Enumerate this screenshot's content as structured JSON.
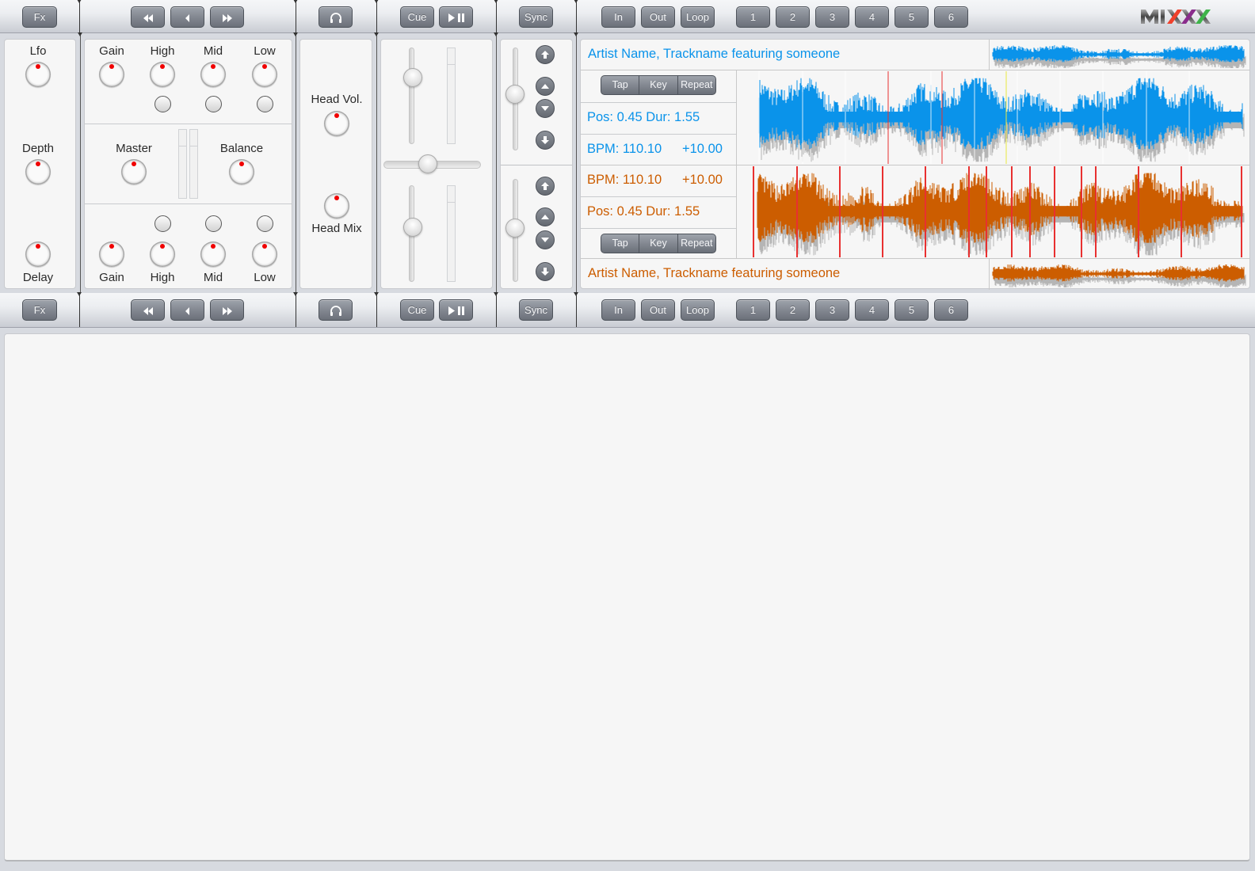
{
  "app": {
    "logo_text": "MIXXX"
  },
  "toolbar_top": {
    "fx_label": "Fx",
    "rewind_icon": "fast-backward-icon",
    "back_icon": "backward-icon",
    "forward_icon": "fast-forward-icon",
    "headphone_icon": "headphones-icon",
    "cue_label": "Cue",
    "play_pause_icon": "play-pause-icon",
    "sync_label": "Sync",
    "loop_in_label": "In",
    "loop_out_label": "Out",
    "loop_label": "Loop",
    "hotcues": [
      "1",
      "2",
      "3",
      "4",
      "5",
      "6"
    ]
  },
  "toolbar_bottom": {
    "fx_label": "Fx",
    "cue_label": "Cue",
    "sync_label": "Sync",
    "loop_in_label": "In",
    "loop_out_label": "Out",
    "loop_label": "Loop",
    "hotcues": [
      "1",
      "2",
      "3",
      "4",
      "5",
      "6"
    ]
  },
  "effects": {
    "lfo": "Lfo",
    "depth": "Depth",
    "delay": "Delay"
  },
  "mixer": {
    "deck1_eq": [
      "Gain",
      "High",
      "Mid",
      "Low"
    ],
    "deck2_eq": [
      "Gain",
      "High",
      "Mid",
      "Low"
    ],
    "master": "Master",
    "balance": "Balance"
  },
  "headphones": {
    "head_vol": "Head Vol.",
    "head_mix": "Head Mix"
  },
  "decks": {
    "deck1": {
      "title": "Artist Name, Trackname featuring someone",
      "position": "Pos: 0.45 Dur: 1.55",
      "bpm": "BPM: 110.10",
      "pitch": "+10.00",
      "buttons": [
        "Tap",
        "Key",
        "Repeat"
      ],
      "color": "#0a93ea"
    },
    "deck2": {
      "title": "Artist Name, Trackname featuring someone",
      "position": "Pos: 0.45 Dur: 1.55",
      "bpm": "BPM: 110.10",
      "pitch": "+10.00",
      "buttons": [
        "Tap",
        "Key",
        "Repeat"
      ],
      "color": "#cc5d00"
    }
  }
}
